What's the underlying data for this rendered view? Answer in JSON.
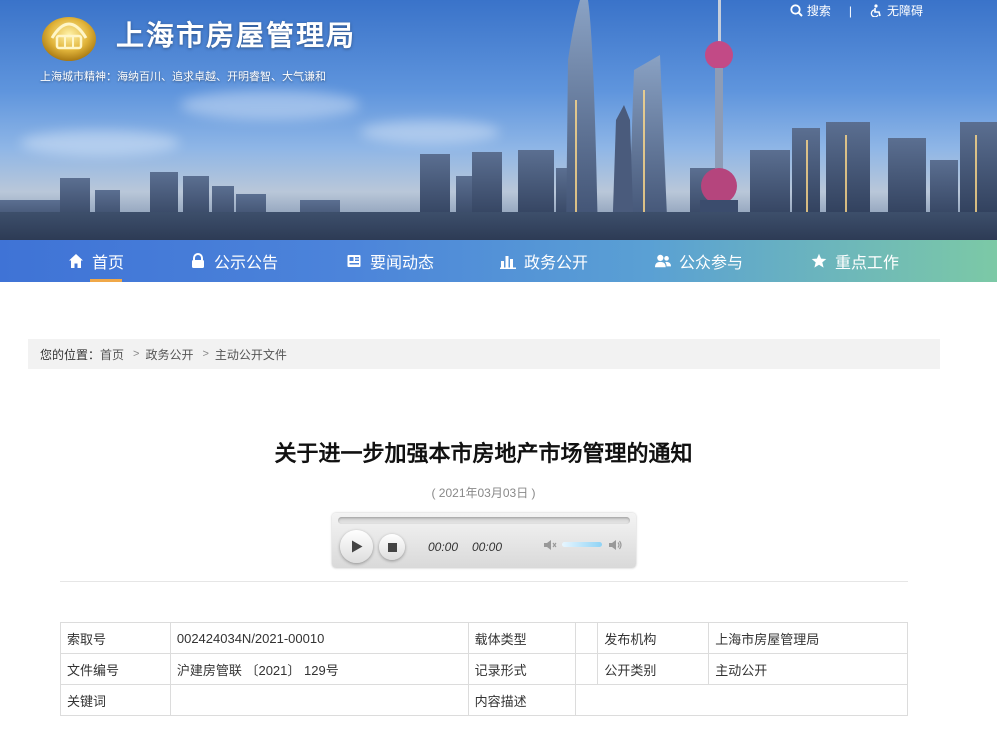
{
  "header": {
    "site_title": "上海市房屋管理局",
    "slogan": "上海城市精神：海纳百川、追求卓越、开明睿智、大气谦和",
    "search_label": "搜索",
    "separator": "|",
    "accessibility_label": "无障碍"
  },
  "nav": {
    "items": [
      {
        "label": "首页",
        "icon": "home-icon",
        "active": true
      },
      {
        "label": "公示公告",
        "icon": "lock-icon"
      },
      {
        "label": "要闻动态",
        "icon": "news-icon"
      },
      {
        "label": "政务公开",
        "icon": "chart-icon"
      },
      {
        "label": "公众参与",
        "icon": "users-icon"
      },
      {
        "label": "重点工作",
        "icon": "star-icon"
      }
    ]
  },
  "breadcrumb": {
    "prefix": "您的位置：",
    "items": [
      "首页",
      "政务公开",
      "主动公开文件"
    ],
    "arrow": ">"
  },
  "article": {
    "title": "关于进一步加强本市房地产市场管理的通知",
    "date": "( 2021年03月03日 )"
  },
  "player": {
    "current_time": "00:00",
    "duration": "00:00"
  },
  "meta_table": {
    "rows": [
      [
        "索取号",
        "002424034N/2021-00010",
        "载体类型",
        "",
        "发布机构",
        "上海市房屋管理局"
      ],
      [
        "文件编号",
        "沪建房管联 〔2021〕 129号",
        "记录形式",
        "",
        "公开类别",
        "主动公开"
      ],
      [
        "关键词",
        "",
        "内容描述",
        ""
      ]
    ]
  },
  "colors": {
    "nav_start": "#3f73d6",
    "nav_end": "#7cc9a6",
    "active_underline": "#f0a848"
  }
}
